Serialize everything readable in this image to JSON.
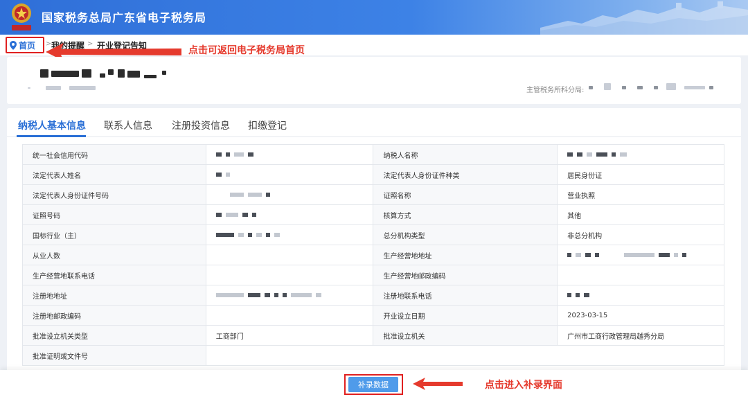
{
  "header": {
    "title": "国家税务总局广东省电子税务局",
    "emblem_text": "中国税务"
  },
  "breadcrumb": {
    "home": "首页",
    "reminders": "我的提醒",
    "current": "开业登记告知",
    "separator": ">"
  },
  "annotations": {
    "home_hint": "点击可返回电子税务局首页",
    "supplement_hint": "点击进入补录界面"
  },
  "company": {
    "tax_office_label": "主管税务所科分局:"
  },
  "tabs": [
    {
      "label": "纳税人基本信息",
      "active": true
    },
    {
      "label": "联系人信息",
      "active": false
    },
    {
      "label": "注册投资信息",
      "active": false
    },
    {
      "label": "扣缴登记",
      "active": false
    }
  ],
  "table": {
    "rows": [
      {
        "l1": "统一社会信用代码",
        "v1": "",
        "l2": "纳税人名称",
        "v2": ""
      },
      {
        "l1": "法定代表人姓名",
        "v1": "",
        "l2": "法定代表人身份证件种类",
        "v2": "居民身份证"
      },
      {
        "l1": "法定代表人身份证件号码",
        "v1": "",
        "l2": "证照名称",
        "v2": "营业执照"
      },
      {
        "l1": "证照号码",
        "v1": "",
        "l2": "核算方式",
        "v2": "其他"
      },
      {
        "l1": "国标行业（主）",
        "v1": "",
        "l2": "总分机构类型",
        "v2": "非总分机构"
      },
      {
        "l1": "从业人数",
        "v1": "",
        "l2": "生产经营地地址",
        "v2": ""
      },
      {
        "l1": "生产经营地联系电话",
        "v1": "",
        "l2": "生产经营地邮政编码",
        "v2": ""
      },
      {
        "l1": "注册地地址",
        "v1": "",
        "l2": "注册地联系电话",
        "v2": ""
      },
      {
        "l1": "注册地邮政编码",
        "v1": "",
        "l2": "开业设立日期",
        "v2": "2023-03-15"
      },
      {
        "l1": "批准设立机关类型",
        "v1": "工商部门",
        "l2": "批准设立机关",
        "v2": "广州市工商行政管理局越秀分局"
      },
      {
        "l1": "批准证明或文件号",
        "v1": "",
        "l2": "",
        "v2": ""
      }
    ]
  },
  "actions": {
    "supplement_button": "补录数据"
  },
  "colors": {
    "primary": "#2a6fd6",
    "annotation_red": "#e53a2d",
    "header_blue": "#2f6fd8",
    "button_blue": "#4f9bea"
  }
}
